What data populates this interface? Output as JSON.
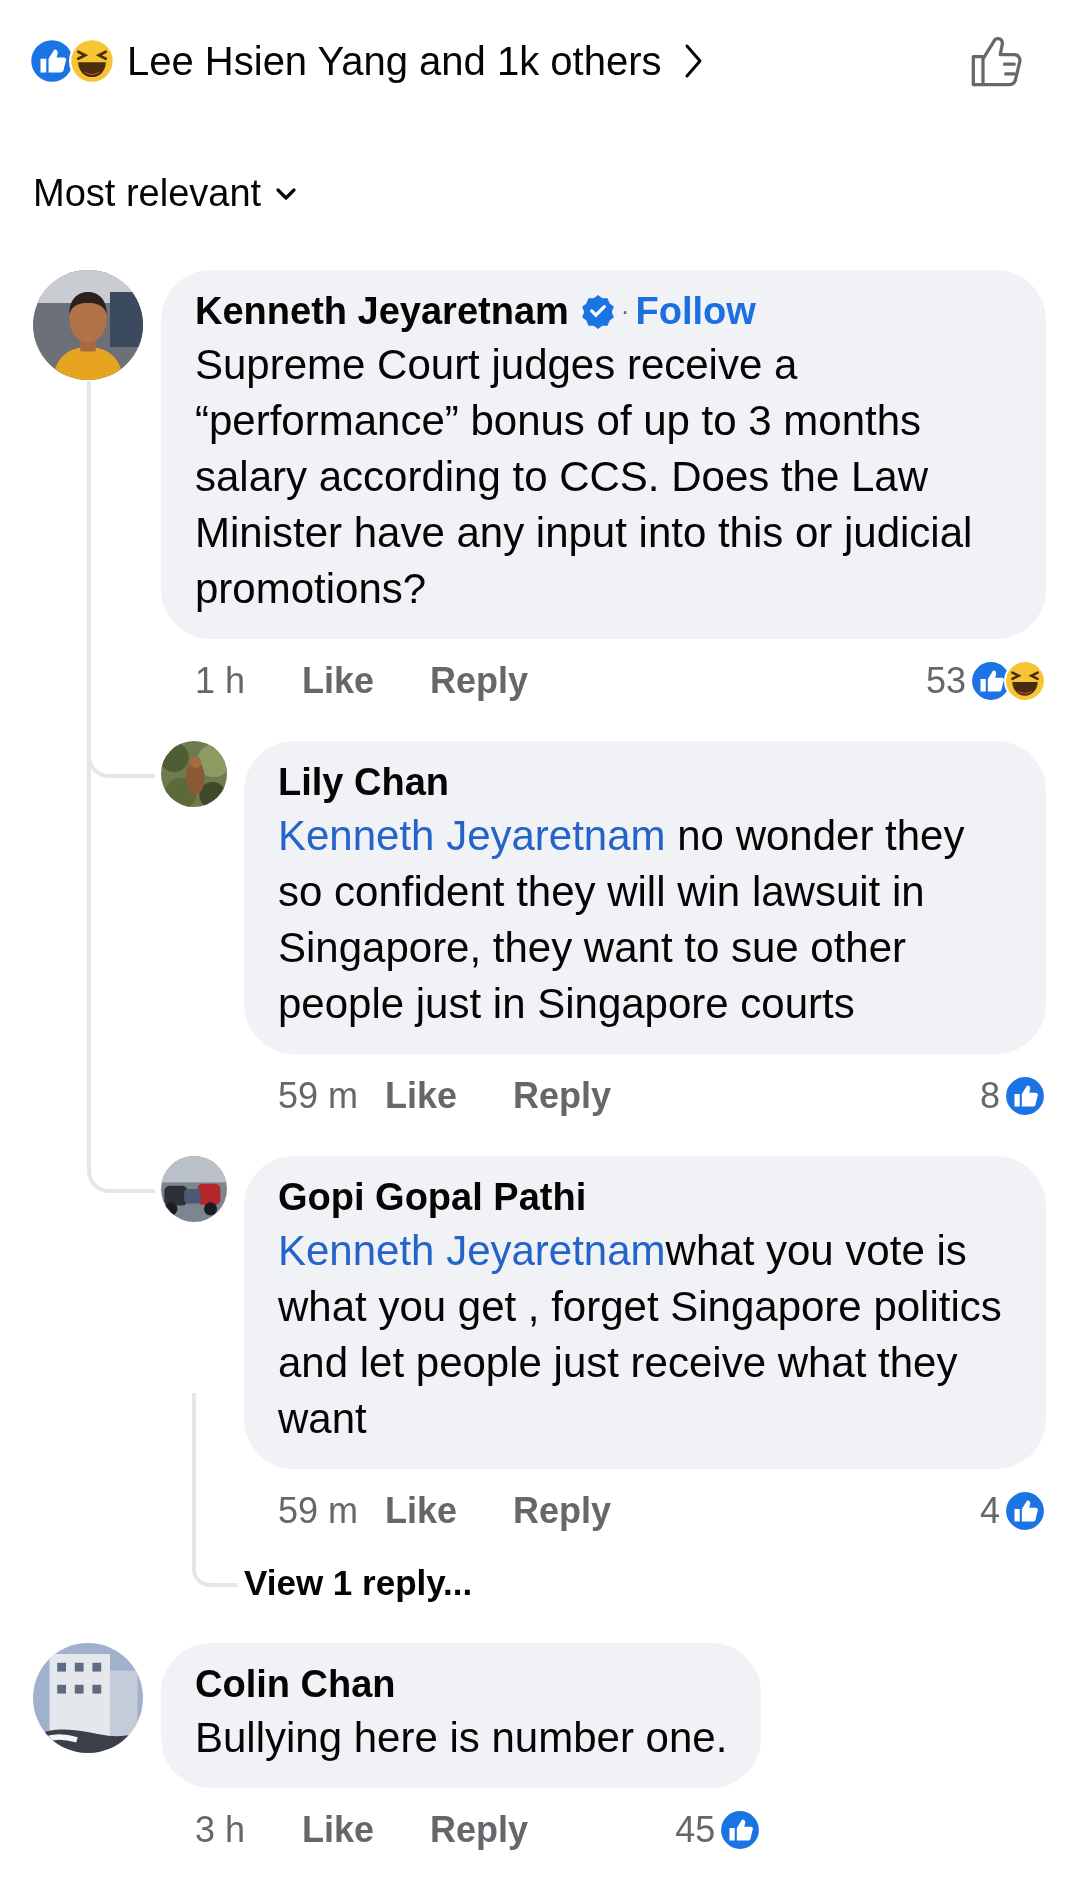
{
  "header": {
    "reactions": [
      {
        "kind": "like"
      },
      {
        "kind": "haha"
      }
    ],
    "summary": "Lee Hsien Yang and 1k others"
  },
  "sort": {
    "label": "Most relevant"
  },
  "comments": [
    {
      "author": "Kenneth Jeyaretnam",
      "verified": true,
      "separator": "·",
      "follow": "Follow",
      "text": "Supreme Court judges receive a “performance” bonus of up to 3 months salary according to CCS. Does the Law Minister have any input into this or judicial promotions?",
      "time": "1 h",
      "like": "Like",
      "reply": "Reply",
      "reaction_count": "53",
      "reactions": [
        {
          "kind": "like"
        },
        {
          "kind": "haha"
        }
      ],
      "replies": [
        {
          "author": "Lily Chan",
          "mention": "Kenneth Jeyaretnam",
          "text": " no wonder they so confident they will win lawsuit in Singapore, they want to sue other people just in Singapore courts",
          "time": "59 m",
          "like": "Like",
          "reply": "Reply",
          "reaction_count": "8",
          "reactions": [
            {
              "kind": "like"
            }
          ]
        },
        {
          "author": "Gopi Gopal Pathi",
          "mention": "Kenneth Jeyaretnam",
          "text": "what you vote is what you get , forget Singapore politics and let people just receive what they want",
          "time": "59 m",
          "like": "Like",
          "reply": "Reply",
          "reaction_count": "4",
          "reactions": [
            {
              "kind": "like"
            }
          ],
          "more_replies": "View 1 reply..."
        }
      ]
    },
    {
      "author": "Colin Chan",
      "text": "Bullying here is number one.",
      "time": "3 h",
      "like": "Like",
      "reply": "Reply",
      "reaction_count": "45",
      "reactions": [
        {
          "kind": "like"
        }
      ]
    }
  ]
}
